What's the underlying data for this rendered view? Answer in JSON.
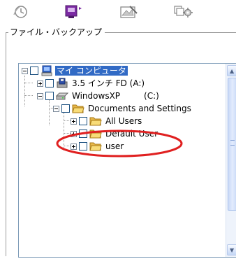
{
  "toolbar": {
    "icons": [
      "clock-icon",
      "screen-icon",
      "edit-image-icon",
      "settings-icon"
    ]
  },
  "group": {
    "label": "ファイル・バックアップ"
  },
  "tree": {
    "nodes": [
      {
        "label": "マイ コンピュータ",
        "icon": "computer-icon",
        "selected": true
      },
      {
        "label": "3.5 インチ FD (A:)",
        "icon": "floppy-drive-icon"
      },
      {
        "label": "WindowsXP",
        "icon": "hard-drive-icon",
        "extra": "(C:)"
      },
      {
        "label": "Documents and Settings",
        "icon": "folder-icon"
      },
      {
        "label": "All Users",
        "icon": "folder-icon"
      },
      {
        "label": "Default User",
        "icon": "folder-icon"
      },
      {
        "label": "user",
        "icon": "folder-icon",
        "highlighted": true
      }
    ]
  },
  "colors": {
    "selection": "#316ac5",
    "highlight_ellipse": "#e02020",
    "folder": "#f4d35e"
  }
}
